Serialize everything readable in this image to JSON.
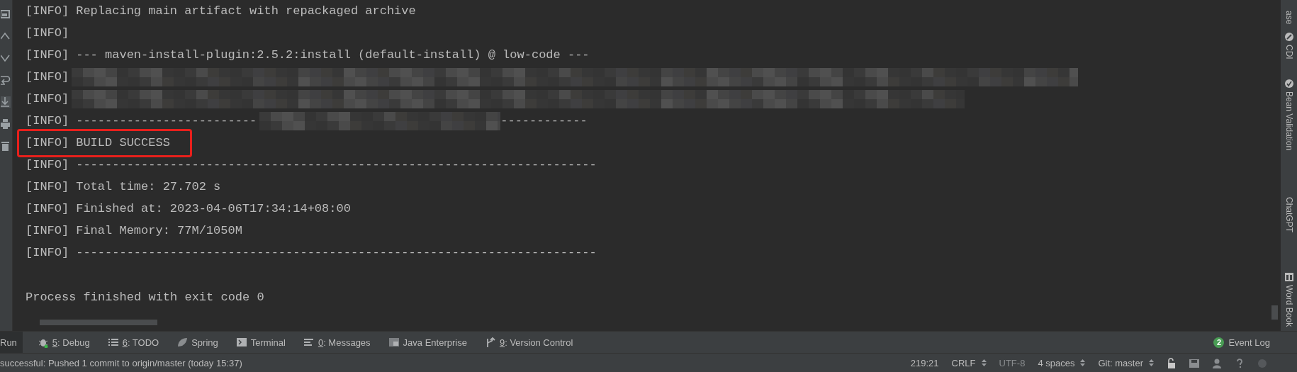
{
  "console": {
    "lines": [
      {
        "prefix": "[INFO]",
        "text": "Replacing main artifact with repackaged archive",
        "kind": "text"
      },
      {
        "prefix": "[INFO]",
        "kind": "text"
      },
      {
        "prefix": "[INFO]",
        "text": "--- maven-install-plugin:2.5.2:install (default-install) @ low-code ---",
        "kind": "text"
      },
      {
        "prefix": "[INFO]",
        "kind": "redacted"
      },
      {
        "prefix": "[INFO]",
        "kind": "redacted"
      },
      {
        "prefix": "[INFO]",
        "text": "-------------------------",
        "tail": "------------",
        "kind": "partly_redacted"
      },
      {
        "prefix": "[INFO]",
        "text": "BUILD SUCCESS",
        "kind": "framed"
      },
      {
        "prefix": "[INFO]",
        "text": "------------------------------------------------------------------------",
        "kind": "text"
      },
      {
        "prefix": "[INFO]",
        "text": "Total time: 27.702 s",
        "kind": "text"
      },
      {
        "prefix": "[INFO]",
        "text": "Finished at: 2023-04-06T17:34:14+08:00",
        "kind": "text"
      },
      {
        "prefix": "[INFO]",
        "text": "Final Memory: 77M/1050M",
        "kind": "text"
      },
      {
        "prefix": "[INFO]",
        "text": "------------------------------------------------------------------------",
        "kind": "text"
      },
      {
        "kind": "blank"
      },
      {
        "text": "Process finished with exit code 0",
        "kind": "plain"
      }
    ]
  },
  "right_sidebar": {
    "items": [
      {
        "label": "ase"
      },
      {
        "label": "CDI"
      },
      {
        "label": "Bean Validation"
      },
      {
        "label": "ChatGPT"
      },
      {
        "label": "Word Book"
      }
    ]
  },
  "tool_windows": {
    "items": [
      {
        "label": "Run",
        "selected": true
      },
      {
        "key": "5",
        "label": ": Debug",
        "selected": false
      },
      {
        "key": "6",
        "label": ": TODO",
        "selected": false
      },
      {
        "label": "Spring",
        "selected": false
      },
      {
        "label": "Terminal",
        "selected": false
      },
      {
        "key": "0",
        "label": ": Messages",
        "selected": false
      },
      {
        "label": "Java Enterprise",
        "selected": false
      },
      {
        "key": "9",
        "label": ": Version Control",
        "selected": false
      }
    ],
    "event_log": {
      "badge": "2",
      "label": "Event Log"
    }
  },
  "status_bar": {
    "message": "successful: Pushed 1 commit to origin/master (today 15:37)",
    "position": "219:21",
    "line_separator": "CRLF",
    "encoding": "UTF-8",
    "indent": "4 spaces",
    "git_branch": "Git: master"
  }
}
